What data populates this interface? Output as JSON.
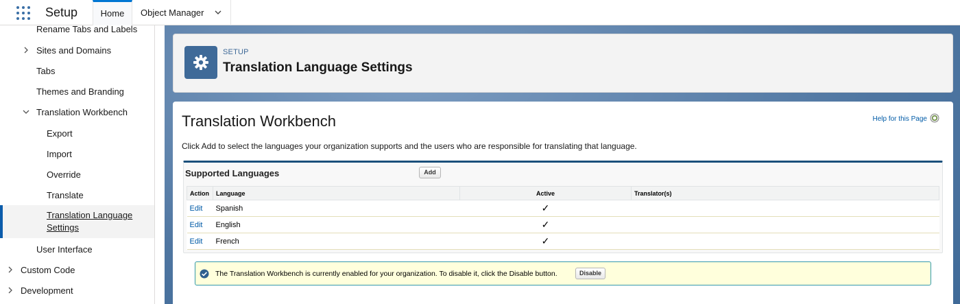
{
  "topbar": {
    "app_title": "Setup",
    "tabs": [
      {
        "label": "Home",
        "active": true
      },
      {
        "label": "Object Manager",
        "has_dropdown": true
      }
    ]
  },
  "sidebar": {
    "items": [
      {
        "label": "Rename Tabs and Labels",
        "level": 1
      },
      {
        "label": "Sites and Domains",
        "level": 1,
        "icon": "chevron-right-icon"
      },
      {
        "label": "Tabs",
        "level": 1
      },
      {
        "label": "Themes and Branding",
        "level": 1
      },
      {
        "label": "Translation Workbench",
        "level": 1,
        "icon": "chevron-down-icon"
      },
      {
        "label": "Export",
        "level": 2
      },
      {
        "label": "Import",
        "level": 2
      },
      {
        "label": "Override",
        "level": 2
      },
      {
        "label": "Translate",
        "level": 2
      },
      {
        "label": "Translation Language Settings",
        "level": 2,
        "selected": true,
        "line1": "Translation Language",
        "line2": "Settings"
      },
      {
        "label": "User Interface",
        "level": 1
      },
      {
        "label": "Custom Code",
        "level": 0,
        "icon": "chevron-right-icon"
      },
      {
        "label": "Development",
        "level": 0,
        "icon": "chevron-right-icon"
      }
    ]
  },
  "header": {
    "eyebrow": "SETUP",
    "title": "Translation Language Settings",
    "icon": "gear-icon"
  },
  "content": {
    "heading": "Translation Workbench",
    "help_link": "Help for this Page",
    "intro": "Click Add to select the languages your organization supports and the users who are responsible for translating that language."
  },
  "supported_languages": {
    "title": "Supported Languages",
    "add_label": "Add",
    "columns": [
      "Action",
      "Language",
      "Active",
      "Translator(s)"
    ],
    "rows": [
      {
        "action": "Edit",
        "language": "Spanish",
        "active": "✓",
        "translators": ""
      },
      {
        "action": "Edit",
        "language": "English",
        "active": "✓",
        "translators": ""
      },
      {
        "action": "Edit",
        "language": "French",
        "active": "✓",
        "translators": ""
      }
    ]
  },
  "info": {
    "text": "The Translation Workbench is currently enabled for your organization. To disable it, click the Disable button.",
    "disable_label": "Disable"
  },
  "colors": {
    "brand_blue": "#3f6a98",
    "link_blue": "#015ba7",
    "tab_accent": "#0176d3",
    "info_bg": "#ffffdc"
  }
}
